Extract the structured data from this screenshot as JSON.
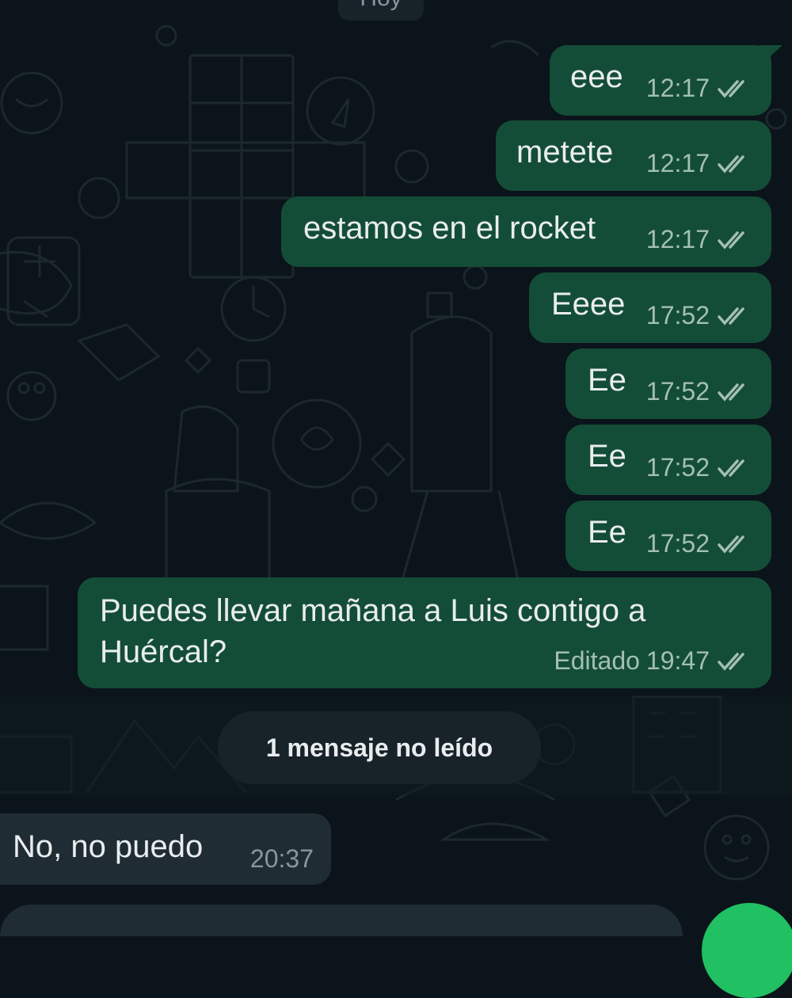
{
  "date_chip": "Hoy",
  "outgoing_messages": [
    {
      "text": "eee",
      "time": "12:17"
    },
    {
      "text": "metete",
      "time": "12:17"
    },
    {
      "text": "estamos en el rocket",
      "time": "12:17"
    },
    {
      "text": "Eeee",
      "time": "17:52"
    },
    {
      "text": "Ee",
      "time": "17:52"
    },
    {
      "text": "Ee",
      "time": "17:52"
    },
    {
      "text": "Ee",
      "time": "17:52"
    }
  ],
  "edited_message": {
    "line1": "Puedes llevar mañana a Luis contigo a",
    "line2": "Huércal?",
    "edited_label": "Editado",
    "time": "19:47"
  },
  "unread_banner": "1 mensaje no leído",
  "incoming_message": {
    "text": "No, no puedo",
    "time": "20:37"
  },
  "icons": [
    "double-check-icon",
    "send-mic-icon"
  ],
  "colors": {
    "background": "#0b141a",
    "outgoing_bubble": "#144d37",
    "incoming_bubble": "#202c33",
    "accent": "#21c063"
  }
}
